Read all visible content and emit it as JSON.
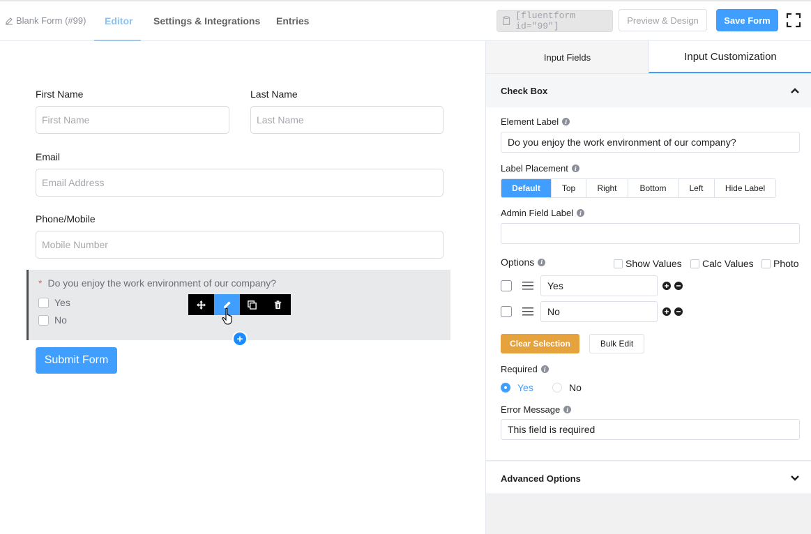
{
  "topbar": {
    "form_name": "Blank Form (#99)",
    "tabs": [
      {
        "label": "Editor",
        "active": true
      },
      {
        "label": "Settings & Integrations",
        "active": false
      },
      {
        "label": "Entries",
        "active": false
      }
    ],
    "shortcode": "[fluentform id=\"99\"]",
    "preview_label": "Preview & Design",
    "save_label": "Save Form"
  },
  "form": {
    "first_name": {
      "label": "First Name",
      "placeholder": "First Name"
    },
    "last_name": {
      "label": "Last Name",
      "placeholder": "Last Name"
    },
    "email": {
      "label": "Email",
      "placeholder": "Email Address"
    },
    "phone": {
      "label": "Phone/Mobile",
      "placeholder": "Mobile Number"
    },
    "checkbox_field": {
      "required_mark": "*",
      "question": "Do you enjoy the work environment of our company?",
      "options": [
        "Yes",
        "No"
      ]
    },
    "submit_label": "Submit Form",
    "add_field_symbol": "+"
  },
  "panel": {
    "tabs": [
      {
        "label": "Input Fields",
        "active": false
      },
      {
        "label": "Input Customization",
        "active": true
      }
    ],
    "section_title": "Check Box",
    "element_label": {
      "label": "Element Label",
      "value": "Do you enjoy the work environment of our company?"
    },
    "label_placement": {
      "label": "Label Placement",
      "options": [
        "Default",
        "Top",
        "Right",
        "Bottom",
        "Left",
        "Hide Label"
      ],
      "selected": "Default"
    },
    "admin_field_label": {
      "label": "Admin Field Label",
      "value": ""
    },
    "options": {
      "label": "Options",
      "toggles": [
        "Show Values",
        "Calc Values",
        "Photo"
      ],
      "rows": [
        "Yes",
        "No"
      ]
    },
    "clear_selection_label": "Clear Selection",
    "bulk_edit_label": "Bulk Edit",
    "required": {
      "label": "Required",
      "choices": [
        "Yes",
        "No"
      ],
      "selected": "Yes"
    },
    "error_message": {
      "label": "Error Message",
      "value": "This field is required"
    },
    "advanced_options_label": "Advanced Options",
    "info_glyph": "i"
  },
  "colors": {
    "accent": "#409eff",
    "warning": "#e6a23c",
    "danger": "#ff6154"
  }
}
